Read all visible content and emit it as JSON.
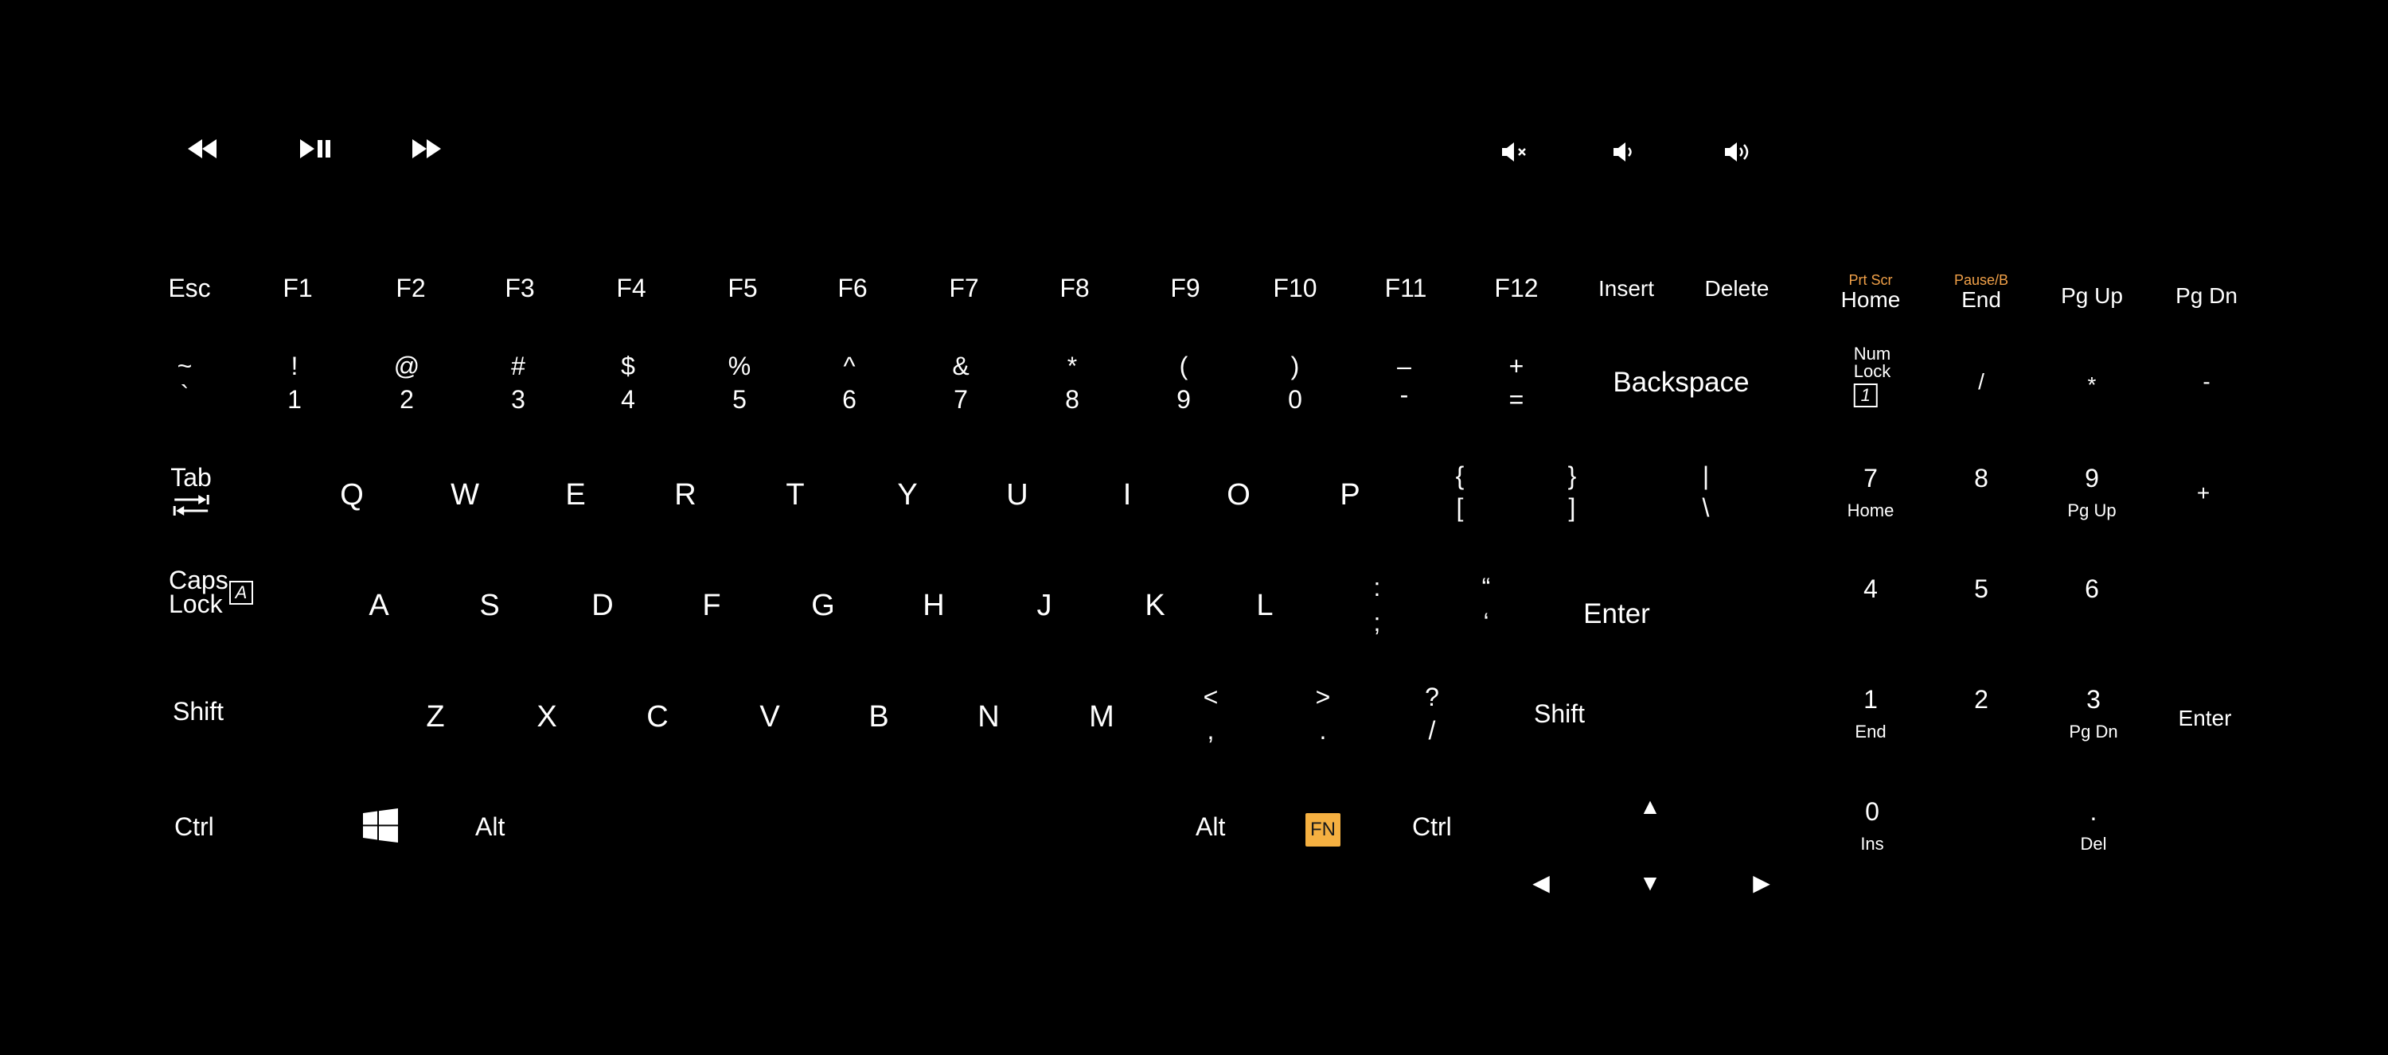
{
  "media": {
    "rewind_icon": "rewind-icon",
    "play_pause_icon": "play-pause-icon",
    "fast_forward_icon": "fast-forward-icon",
    "mute_icon": "volume-mute-icon",
    "volume_down_icon": "volume-down-icon",
    "volume_up_icon": "volume-up-icon"
  },
  "function_row": {
    "esc": "Esc",
    "f": [
      "F1",
      "F2",
      "F3",
      "F4",
      "F5",
      "F6",
      "F7",
      "F8",
      "F9",
      "F10",
      "F11",
      "F12"
    ],
    "insert": "Insert",
    "delete": "Delete",
    "home_alt": "Prt Scr",
    "home": "Home",
    "end_alt": "Pause/B",
    "end": "End",
    "pgup": "Pg Up",
    "pgdn": "Pg Dn"
  },
  "number_row": {
    "keys": [
      {
        "shift": "~",
        "base": "`"
      },
      {
        "shift": "!",
        "base": "1"
      },
      {
        "shift": "@",
        "base": "2"
      },
      {
        "shift": "#",
        "base": "3"
      },
      {
        "shift": "$",
        "base": "4"
      },
      {
        "shift": "%",
        "base": "5"
      },
      {
        "shift": "^",
        "base": "6"
      },
      {
        "shift": "&",
        "base": "7"
      },
      {
        "shift": "*",
        "base": "8"
      },
      {
        "shift": "(",
        "base": "9"
      },
      {
        "shift": ")",
        "base": "0"
      },
      {
        "shift": "–",
        "base": "-"
      },
      {
        "shift": "+",
        "base": "="
      }
    ],
    "backspace": "Backspace"
  },
  "top_row": {
    "tab": "Tab",
    "letters": [
      "Q",
      "W",
      "E",
      "R",
      "T",
      "Y",
      "U",
      "I",
      "O",
      "P"
    ],
    "brace_open": {
      "shift": "{",
      "base": "["
    },
    "brace_close": {
      "shift": "}",
      "base": "]"
    },
    "pipe": {
      "shift": "|",
      "base": "\\"
    }
  },
  "home_row": {
    "caps_line1": "Caps",
    "caps_line2": "Lock",
    "caps_glyph": "A",
    "letters": [
      "A",
      "S",
      "D",
      "F",
      "G",
      "H",
      "J",
      "K",
      "L"
    ],
    "semicolon": {
      "shift": ":",
      "base": ";"
    },
    "quote": {
      "shift": "“",
      "base": "‘"
    },
    "enter": "Enter"
  },
  "bottom_row": {
    "shift_left": "Shift",
    "letters": [
      "Z",
      "X",
      "C",
      "V",
      "B",
      "N",
      "M"
    ],
    "comma": {
      "shift": "<",
      "base": ","
    },
    "period": {
      "shift": ">",
      "base": "."
    },
    "slash": {
      "shift": "?",
      "base": "/"
    },
    "shift_right": "Shift"
  },
  "space_row": {
    "ctrl_left": "Ctrl",
    "windows_icon": "windows-logo-icon",
    "alt_left": "Alt",
    "alt_right": "Alt",
    "fn": "FN",
    "ctrl_right": "Ctrl"
  },
  "arrows": {
    "up": "▲",
    "left": "◀",
    "down": "▼",
    "right": "▶"
  },
  "numpad": {
    "numlock_line1": "Num",
    "numlock_line2": "Lock",
    "numlock_glyph": "1",
    "divide": "/",
    "multiply": "*",
    "minus": "-",
    "n7": "7",
    "n7_sub": "Home",
    "n8": "8",
    "n9": "9",
    "n9_sub": "Pg Up",
    "plus": "+",
    "n4": "4",
    "n5": "5",
    "n6": "6",
    "n1": "1",
    "n1_sub": "End",
    "n2": "2",
    "n3": "3",
    "n3_sub": "Pg Dn",
    "enter": "Enter",
    "n0": "0",
    "n0_sub": "Ins",
    "dot": ".",
    "dot_sub": "Del"
  },
  "colors": {
    "background": "#000000",
    "key_text": "#ffffff",
    "alt_legend": "#f0a048",
    "fn_key": "#f5b041"
  }
}
